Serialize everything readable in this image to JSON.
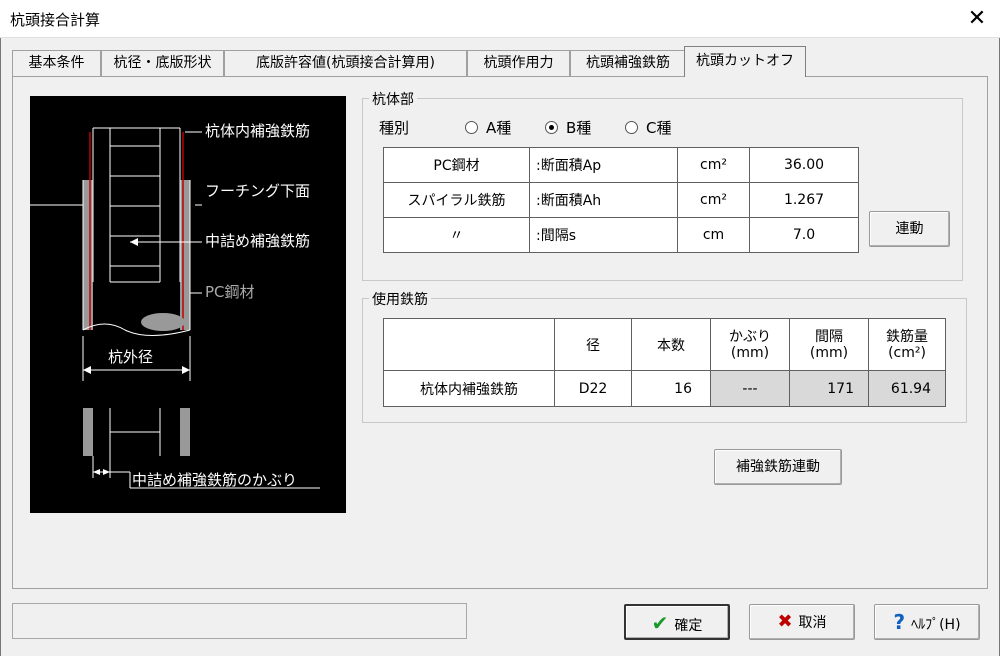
{
  "window": {
    "title": "杭頭接合計算",
    "close_glyph": "✕"
  },
  "tabs": [
    {
      "label": "基本条件"
    },
    {
      "label": "杭径・底版形状"
    },
    {
      "label": "底版許容値(杭頭接合計算用)"
    },
    {
      "label": "杭頭作用力"
    },
    {
      "label": "杭頭補強鉄筋"
    },
    {
      "label": "杭頭カットオフ",
      "active": true
    }
  ],
  "diagram": {
    "labels": {
      "inner_rebar": "杭体内補強鉄筋",
      "footing_bottom": "フーチング下面",
      "filler_rebar": "中詰め補強鉄筋",
      "pc_steel": "PC鋼材",
      "pile_diameter": "杭外径",
      "filler_cover": "中詰め補強鉄筋のかぶり"
    }
  },
  "pile_body": {
    "group_label": "杭体部",
    "type_label": "種別",
    "types": [
      {
        "label": "A種",
        "selected": false
      },
      {
        "label": "B種",
        "selected": true
      },
      {
        "label": "C種",
        "selected": false
      }
    ],
    "rows": [
      {
        "name": "PC鋼材",
        "desc": ":断面積Ap",
        "unit": "cm²",
        "value": "36.00"
      },
      {
        "name": "スパイラル鉄筋",
        "desc": ":断面積Ah",
        "unit": "cm²",
        "value": "1.267"
      },
      {
        "name": "〃",
        "desc": ":間隔s",
        "unit": "cm",
        "value": "7.0"
      }
    ],
    "link_button": "連動"
  },
  "rebar": {
    "group_label": "使用鉄筋",
    "headers": {
      "diameter": "径",
      "count": "本数",
      "cover": "かぶり",
      "cover_unit": "(mm)",
      "spacing": "間隔",
      "spacing_unit": "(mm)",
      "amount": "鉄筋量",
      "amount_unit": "(cm²)"
    },
    "row": {
      "name": "杭体内補強鉄筋",
      "diameter": "D22",
      "count": "16",
      "cover": "---",
      "spacing": "171",
      "amount": "61.94"
    },
    "link_button": "補強鉄筋連動"
  },
  "footer": {
    "ok": "確定",
    "cancel": "取消",
    "help": "ﾍﾙﾌﾟ(H)"
  },
  "colors": {
    "accent_red": "#c00000",
    "check_green": "#1a9a2a",
    "help_blue": "#1060c0"
  }
}
